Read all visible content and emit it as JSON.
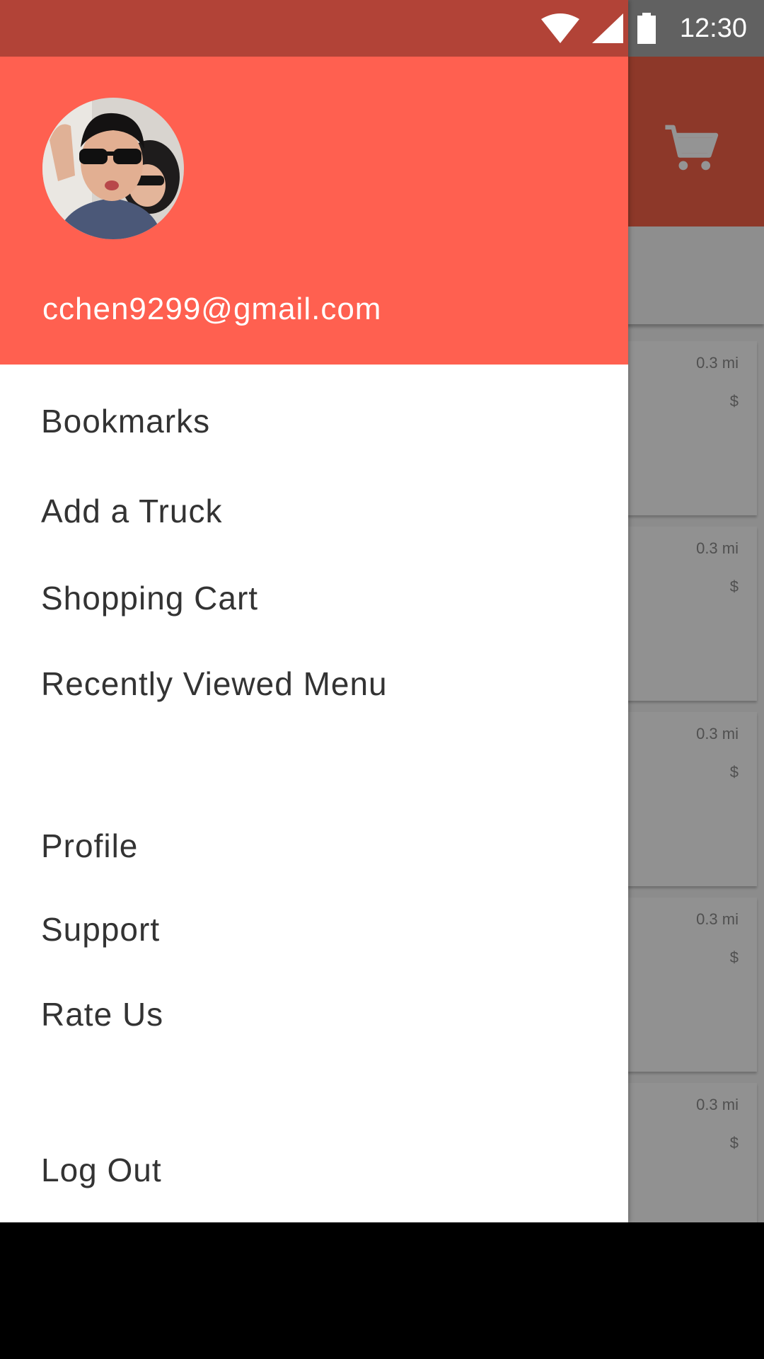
{
  "status_bar": {
    "time": "12:30",
    "icons": [
      "wifi-icon",
      "cellular-signal-icon",
      "battery-icon"
    ]
  },
  "drawer": {
    "email": "cchen9299@gmail.com",
    "menu": {
      "bookmarks": "Bookmarks",
      "add_truck": "Add a Truck",
      "shopping_cart": "Shopping Cart",
      "recently_viewed": "Recently Viewed Menu",
      "profile": "Profile",
      "support": "Support",
      "rate_us": "Rate Us",
      "log_out": "Log Out"
    }
  },
  "background_app": {
    "toolbar_icon": "cart-icon",
    "cards": [
      {
        "distance": "0.3 mi",
        "price": "$"
      },
      {
        "distance": "0.3 mi",
        "price": "$"
      },
      {
        "distance": "0.3 mi",
        "price": "$"
      },
      {
        "distance": "0.3 mi",
        "price": "$"
      },
      {
        "distance": "0.3 mi",
        "price": "$"
      }
    ]
  },
  "colors": {
    "header": "#ff6050",
    "toolbar": "#f36148",
    "drawer_bg": "#ffffff",
    "menu_text": "#333333"
  }
}
